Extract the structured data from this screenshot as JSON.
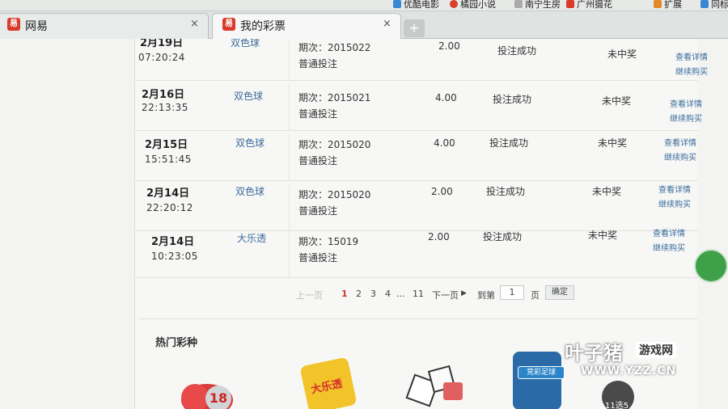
{
  "bookmarks": [
    {
      "label": "优酷电影",
      "color": "#3a86d4"
    },
    {
      "label": "橘园小说",
      "color": "#4aa54a"
    },
    {
      "label": "南宁生房",
      "color": "#3a86d4"
    },
    {
      "label": "广州摄花",
      "color": "#d93a2b"
    },
    {
      "label": "扩展",
      "color": "#e08a2a"
    },
    {
      "label": "同标",
      "color": "#3a86d4"
    }
  ],
  "tabs": [
    {
      "label": "网易",
      "close": "×"
    },
    {
      "label": "我的彩票",
      "close": "×"
    }
  ],
  "newtab_label": "+",
  "orders": [
    {
      "date": "2月19日",
      "time": "07:20:24",
      "game": "双色球",
      "issue": "期次：2015022",
      "mode": "普通投注",
      "amount": "2.00",
      "status": "投注成功",
      "result": "未中奖",
      "detail": "查看详情",
      "rebuy": "继续购买"
    },
    {
      "date": "2月16日",
      "time": "22:13:35",
      "game": "双色球",
      "issue": "期次：2015021",
      "mode": "普通投注",
      "amount": "4.00",
      "status": "投注成功",
      "result": "未中奖",
      "detail": "查看详情",
      "rebuy": "继续购买"
    },
    {
      "date": "2月15日",
      "time": "15:51:45",
      "game": "双色球",
      "issue": "期次：2015020",
      "mode": "普通投注",
      "amount": "4.00",
      "status": "投注成功",
      "result": "未中奖",
      "detail": "查看详情",
      "rebuy": "继续购买"
    },
    {
      "date": "2月14日",
      "time": "22:20:12",
      "game": "双色球",
      "issue": "期次：2015020",
      "mode": "普通投注",
      "amount": "2.00",
      "status": "投注成功",
      "result": "未中奖",
      "detail": "查看详情",
      "rebuy": "继续购买"
    },
    {
      "date": "2月14日",
      "time": "10:23:05",
      "game": "大乐透",
      "issue": "期次：15019",
      "mode": "普通投注",
      "amount": "2.00",
      "status": "投注成功",
      "result": "未中奖",
      "detail": "查看详情",
      "rebuy": "继续购买"
    }
  ],
  "pager": {
    "prev": "上一页",
    "pages": [
      "1",
      "2",
      "3",
      "4"
    ],
    "ellipsis": "...",
    "last": "11",
    "next": "下一页",
    "goto_prefix": "到第",
    "goto_value": "1",
    "goto_suffix": "页",
    "confirm": "确定"
  },
  "hot": {
    "title": "热门彩种",
    "items": [
      {
        "icon": "ssq-balls-icon",
        "text": "18"
      },
      {
        "icon": "dlt-star-icon",
        "text": "大乐透"
      },
      {
        "icon": "dice-icon",
        "text": ""
      },
      {
        "icon": "football-shirt-icon",
        "text": "竞彩足球"
      },
      {
        "icon": "11x5-icon",
        "text": "11选5"
      }
    ]
  },
  "watermark": {
    "main": "叶子猪",
    "tag": "游戏网",
    "url": "WWW.YZZ.CN"
  },
  "colors": {
    "accent_link": "#3a6a9a",
    "current_page": "#d0352a",
    "brand_red": "#d93a2b"
  }
}
